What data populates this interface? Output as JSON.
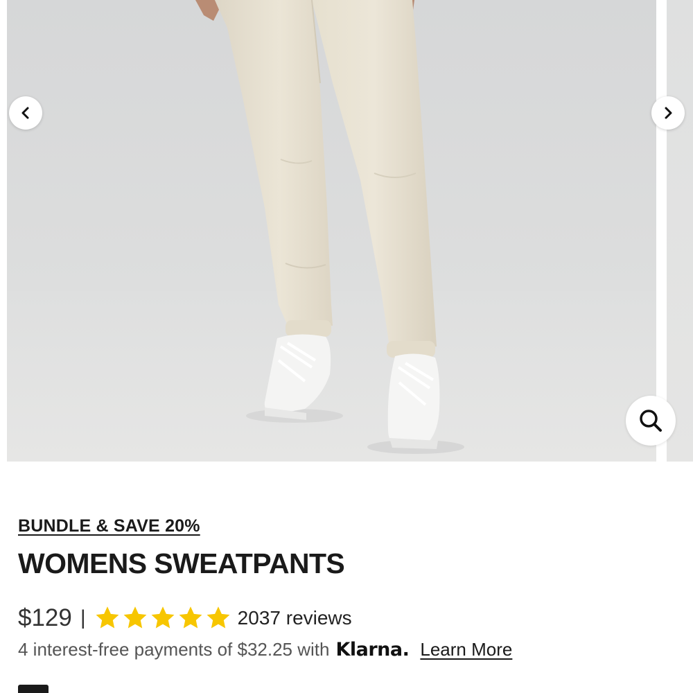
{
  "gallery": {
    "image_alt": "Model wearing cream womens sweatpants with white sneakers",
    "prev_icon": "chevron-left-icon",
    "next_icon": "chevron-right-icon",
    "zoom_icon": "magnifier-icon"
  },
  "product": {
    "promo_link": "BUNDLE & SAVE 20%",
    "title": "WOMENS SWEATPANTS",
    "price": "$129",
    "divider": "|",
    "rating": 5,
    "star_color": "#F7C600",
    "reviews_label": "2037 reviews"
  },
  "payments": {
    "text": "4 interest-free payments of $32.25 with",
    "provider": "Klarna.",
    "learn_more": "Learn More"
  }
}
